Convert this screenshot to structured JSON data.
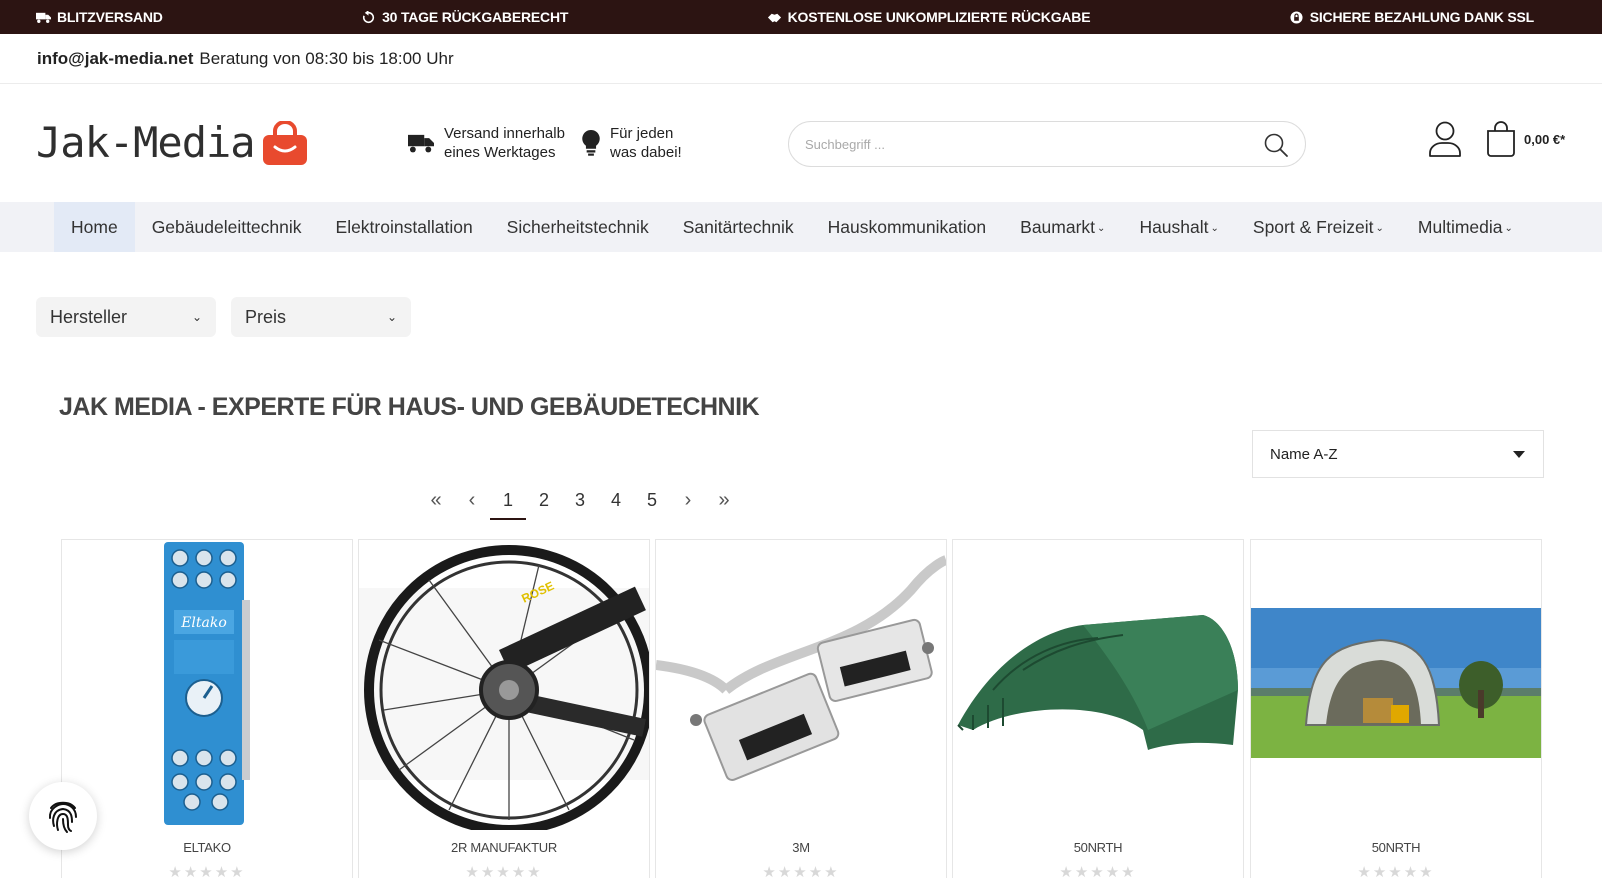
{
  "usp": [
    {
      "icon": "truck-icon",
      "label": "BLITZVERSAND"
    },
    {
      "icon": "return-icon",
      "label": "30 TAGE RÜCKGABERECHT"
    },
    {
      "icon": "handshake-icon",
      "label": "KOSTENLOSE UNKOMPLIZIERTE RÜCKGABE"
    },
    {
      "icon": "globe-lock-icon",
      "label": "SICHERE BEZAHLUNG DANK SSL"
    }
  ],
  "contact": {
    "email": "info@jak-media.net",
    "hours": "Beratung von 08:30 bis 18:00 Uhr"
  },
  "header": {
    "logo_text": "Jak-Media",
    "features": [
      {
        "icon": "truck-icon",
        "line1": "Versand innerhalb",
        "line2": "eines Werktages"
      },
      {
        "icon": "lightbulb-icon",
        "line1": "Für jeden",
        "line2": "was dabei!"
      }
    ],
    "search_placeholder": "Suchbegriff ...",
    "cart_total": "0,00 €*"
  },
  "nav": {
    "items": [
      {
        "label": "Home",
        "dropdown": false
      },
      {
        "label": "Gebäudeleittechnik",
        "dropdown": false
      },
      {
        "label": "Elektroinstallation",
        "dropdown": false
      },
      {
        "label": "Sicherheitstechnik",
        "dropdown": false
      },
      {
        "label": "Sanitärtechnik",
        "dropdown": false
      },
      {
        "label": "Hauskommunikation",
        "dropdown": false
      },
      {
        "label": "Baumarkt",
        "dropdown": true
      },
      {
        "label": "Haushalt",
        "dropdown": true
      },
      {
        "label": "Sport & Freizeit",
        "dropdown": true
      },
      {
        "label": "Multimedia",
        "dropdown": true
      }
    ]
  },
  "filters": {
    "manufacturer": "Hersteller",
    "price": "Preis"
  },
  "page_title": "JAK MEDIA - EXPERTE FÜR HAUS- UND GEBÄUDETECHNIK",
  "sort": {
    "selected": "Name A-Z"
  },
  "pagination": {
    "first": "«",
    "prev": "‹",
    "pages": [
      "1",
      "2",
      "3",
      "4",
      "5"
    ],
    "current": "1",
    "next": "›",
    "last": "»"
  },
  "products": [
    {
      "manufacturer": "ELTAKO",
      "rating": 0,
      "image": "din-rail-dimmer-image"
    },
    {
      "manufacturer": "2R MANUFAKTUR",
      "rating": 0,
      "image": "bicycle-rear-wheel-image"
    },
    {
      "manufacturer": "3M",
      "rating": 0,
      "image": "data-cable-image"
    },
    {
      "manufacturer": "50NRTH",
      "rating": 0,
      "image": "green-tent-image"
    },
    {
      "manufacturer": "50NRTH",
      "rating": 0,
      "image": "field-shelter-image"
    }
  ],
  "colors": {
    "top_bar": "#2c1412",
    "nav_background": "#f1f2f6",
    "nav_active": "#e3eaf6",
    "logo_bag": "#e84a2e"
  }
}
